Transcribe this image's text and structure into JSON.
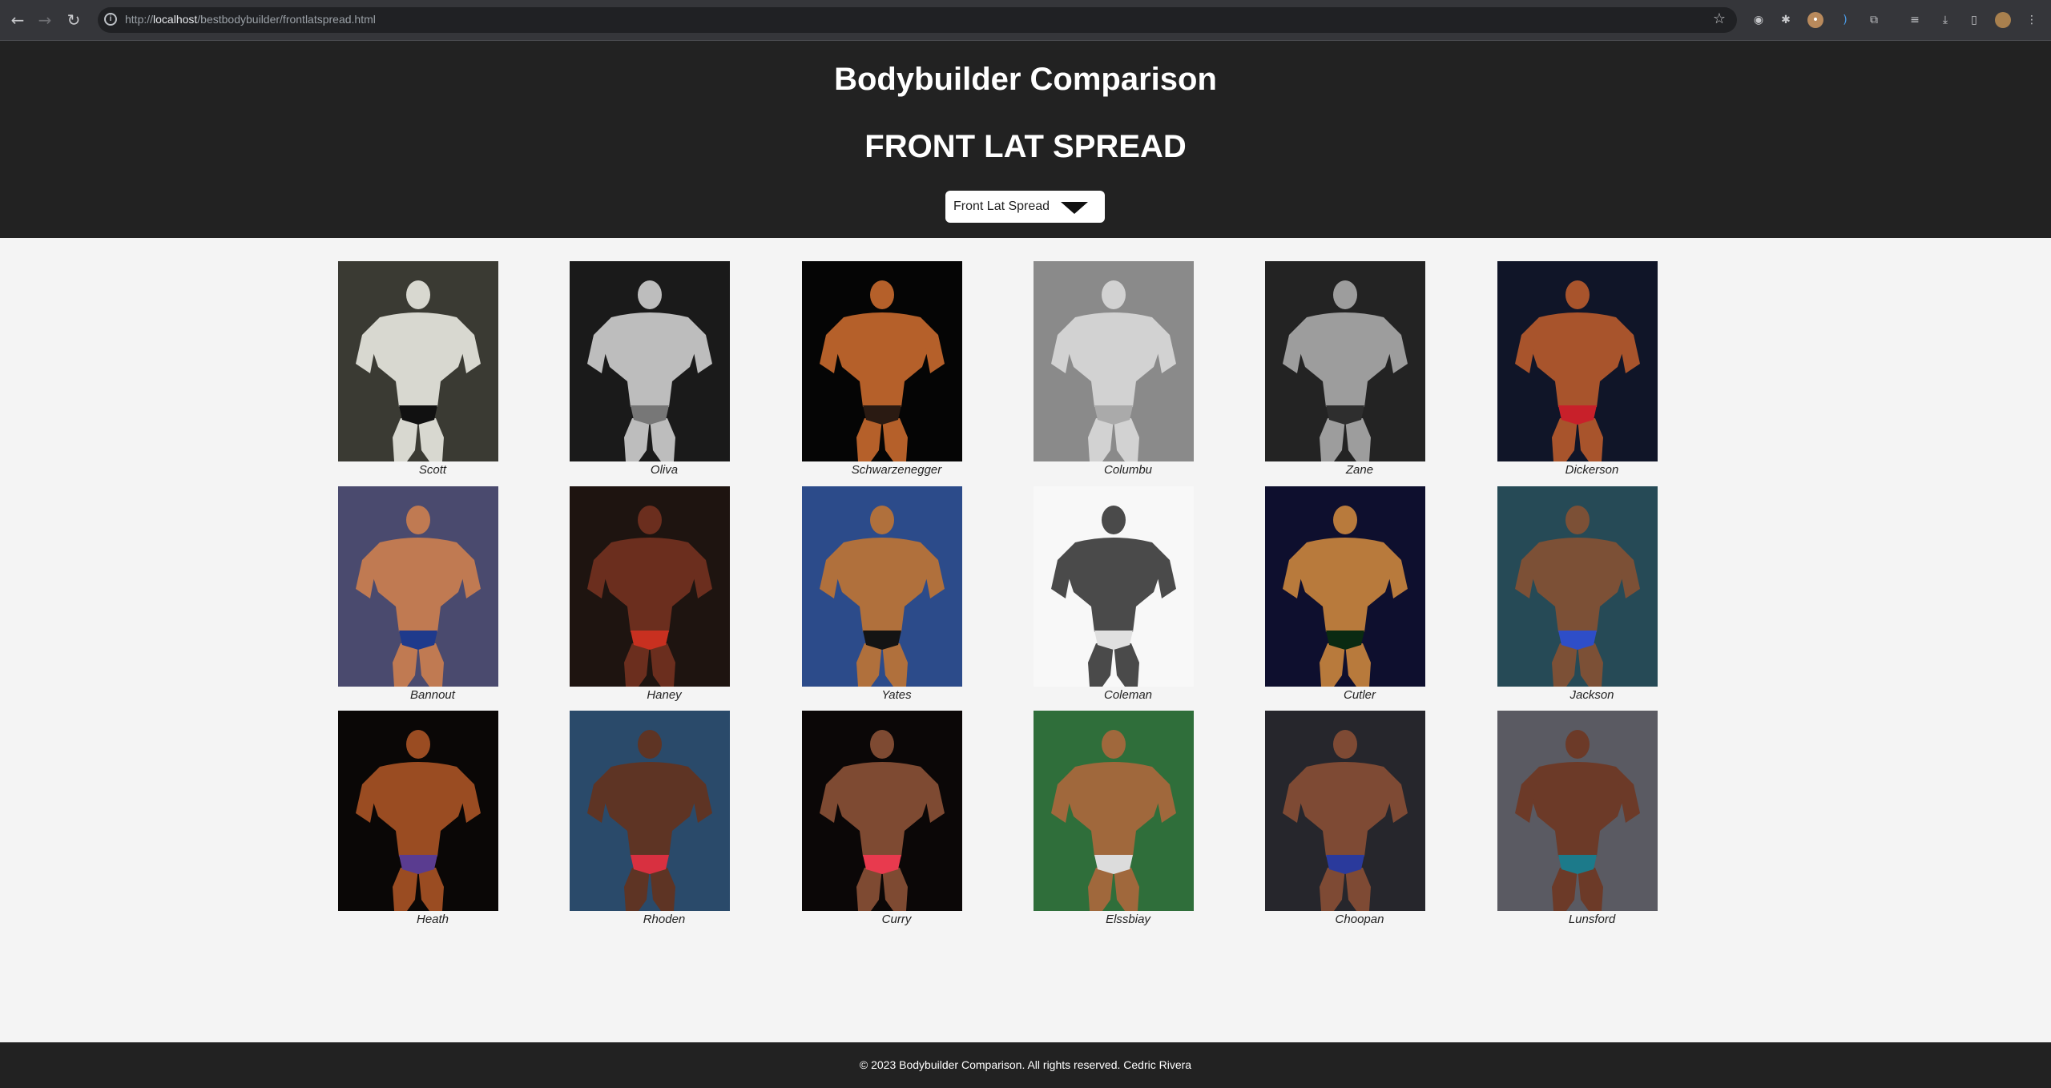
{
  "browser": {
    "url_prefix": "http://",
    "url_host": "localhost",
    "url_path": "/bestbodybuilder/frontlatspread.html"
  },
  "header": {
    "site_title": "Bodybuilder Comparison",
    "pose_title": "FRONT LAT SPREAD",
    "pose_select": {
      "selected": "Front Lat Spread"
    }
  },
  "gallery": [
    {
      "name": "Scott",
      "bg": "#3a3a33",
      "skin": "#d8d8d0",
      "trunks": "#111111"
    },
    {
      "name": "Oliva",
      "bg": "#1a1a1a",
      "skin": "#bdbdbd",
      "trunks": "#777777"
    },
    {
      "name": "Schwarzenegger",
      "bg": "#050505",
      "skin": "#b5602a",
      "trunks": "#2a1a12"
    },
    {
      "name": "Columbu",
      "bg": "#8a8a8a",
      "skin": "#d2d2d2",
      "trunks": "#aaaaaa"
    },
    {
      "name": "Zane",
      "bg": "#232323",
      "skin": "#9d9d9d",
      "trunks": "#2e2e2e"
    },
    {
      "name": "Dickerson",
      "bg": "#101528",
      "skin": "#a8542c",
      "trunks": "#c8202a"
    },
    {
      "name": "Bannout",
      "bg": "#4a4a6e",
      "skin": "#c07a52",
      "trunks": "#1f3a8c"
    },
    {
      "name": "Haney",
      "bg": "#1e1410",
      "skin": "#6b2e1e",
      "trunks": "#c83020"
    },
    {
      "name": "Yates",
      "bg": "#2c4b8a",
      "skin": "#b0703c",
      "trunks": "#141414"
    },
    {
      "name": "Coleman",
      "bg": "#f8f8f8",
      "skin": "#4a4a4a",
      "trunks": "#e0e0e0"
    },
    {
      "name": "Cutler",
      "bg": "#0e0f2e",
      "skin": "#b87a3c",
      "trunks": "#0a2a12"
    },
    {
      "name": "Jackson",
      "bg": "#264a56",
      "skin": "#7c5036",
      "trunks": "#2e4ec8"
    },
    {
      "name": "Heath",
      "bg": "#0a0706",
      "skin": "#9a4c22",
      "trunks": "#5a3c90"
    },
    {
      "name": "Rhoden",
      "bg": "#2a4a6a",
      "skin": "#5e3424",
      "trunks": "#d83040"
    },
    {
      "name": "Curry",
      "bg": "#0b0707",
      "skin": "#7e4a32",
      "trunks": "#e83a4e"
    },
    {
      "name": "Elssbiay",
      "bg": "#2f6e3a",
      "skin": "#a0683c",
      "trunks": "#dcdcdc"
    },
    {
      "name": "Choopan",
      "bg": "#26262c",
      "skin": "#7e4a34",
      "trunks": "#2a3a9c"
    },
    {
      "name": "Lunsford",
      "bg": "#5a5a62",
      "skin": "#6c3a28",
      "trunks": "#1c7a8a"
    }
  ],
  "footer": {
    "text": "© 2023 Bodybuilder Comparison. All rights reserved. Cedric Rivera"
  }
}
